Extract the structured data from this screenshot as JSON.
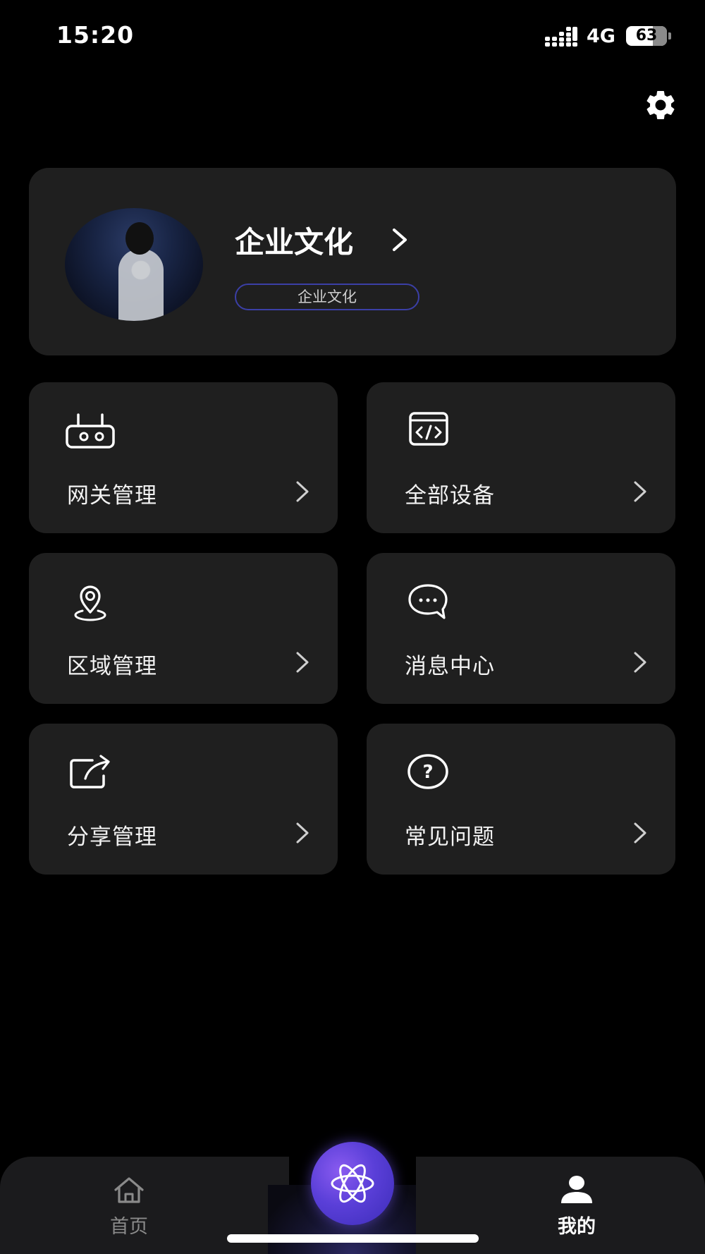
{
  "status_bar": {
    "time": "15:20",
    "network": "4G",
    "battery": "63"
  },
  "header": {
    "settings_icon": "gear-icon"
  },
  "profile": {
    "name": "企业文化",
    "tag": "企业文化"
  },
  "menu": [
    {
      "label": "网关管理",
      "icon": "gateway-router-icon"
    },
    {
      "label": "全部设备",
      "icon": "code-window-icon"
    },
    {
      "label": "区域管理",
      "icon": "location-pin-icon"
    },
    {
      "label": "消息中心",
      "icon": "chat-bubble-icon"
    },
    {
      "label": "分享管理",
      "icon": "share-icon"
    },
    {
      "label": "常见问题",
      "icon": "question-icon"
    }
  ],
  "tabbar": {
    "home_label": "首页",
    "me_label": "我的",
    "active": "我的",
    "center_icon": "atom-icon"
  },
  "colors": {
    "background": "#000000",
    "card": "#1f1f1f",
    "accent": "#5a3fd8",
    "tag_border": "#3b3fa6"
  }
}
